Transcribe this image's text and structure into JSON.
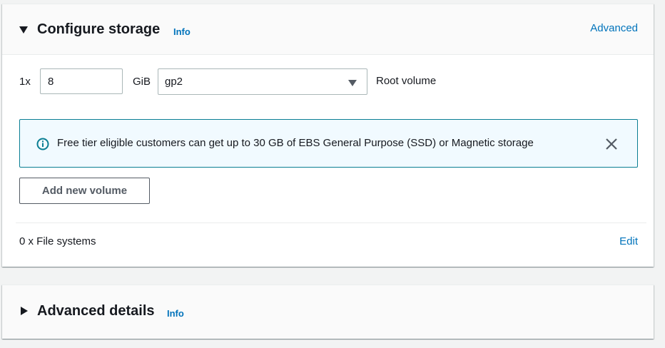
{
  "storage": {
    "title": "Configure storage",
    "info_label": "Info",
    "advanced_label": "Advanced",
    "volume": {
      "multiplier": "1x",
      "size_value": "8",
      "unit": "GiB",
      "type_value": "gp2",
      "root_label": "Root volume"
    },
    "notice": {
      "text": "Free tier eligible customers can get up to 30 GB of EBS General Purpose (SSD) or Magnetic storage",
      "icon": "info-circle-icon",
      "close_icon": "close-icon"
    },
    "add_volume_label": "Add new volume",
    "file_systems_label": "0 x File systems",
    "edit_label": "Edit"
  },
  "advanced_details": {
    "title": "Advanced details",
    "info_label": "Info"
  },
  "colors": {
    "link": "#0073bb",
    "notice_border": "#0a7e93",
    "notice_bg": "#f1faff",
    "header_bg": "#fafafa",
    "page_bg": "#f2f3f3"
  }
}
